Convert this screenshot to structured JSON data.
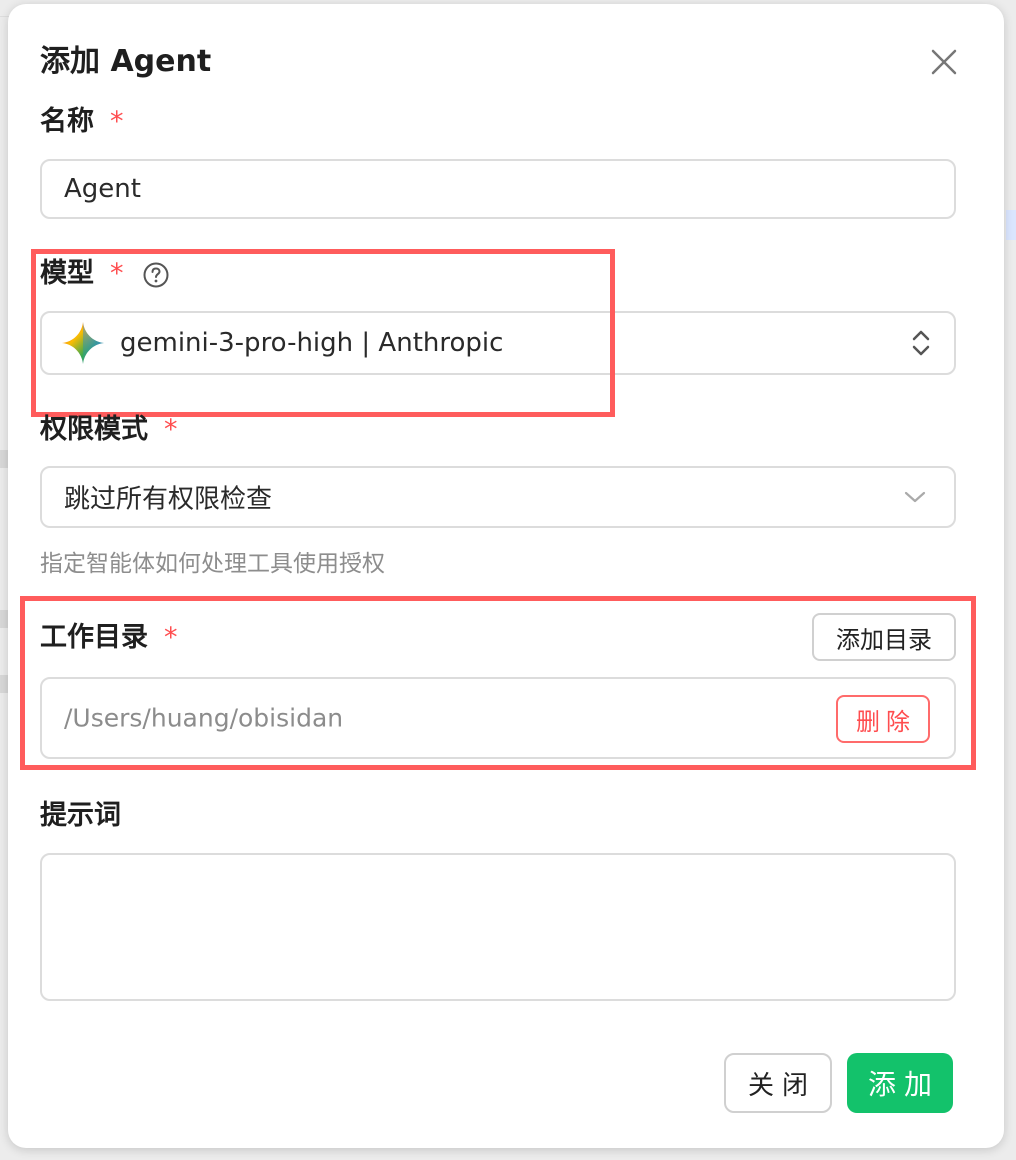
{
  "modal": {
    "title": "添加 Agent"
  },
  "fields": {
    "name": {
      "label": "名称",
      "required": "*",
      "value": "Agent"
    },
    "model": {
      "label": "模型",
      "required": "*",
      "value": "gemini-3-pro-high | Anthropic",
      "icon": "gemini-icon"
    },
    "permission": {
      "label": "权限模式",
      "required": "*",
      "value": "跳过所有权限检查",
      "help": "指定智能体如何处理工具使用授权"
    },
    "workdir": {
      "label": "工作目录",
      "required": "*",
      "add_button": "添加目录",
      "path": "/Users/huang/obisidan",
      "delete_button": "删除"
    },
    "prompt": {
      "label": "提示词",
      "value": ""
    }
  },
  "footer": {
    "close_button": "关闭",
    "add_button": "添加"
  },
  "colors": {
    "primary": "#13c26b",
    "danger": "#ff4d4f",
    "highlight": "#ff5c5c"
  }
}
